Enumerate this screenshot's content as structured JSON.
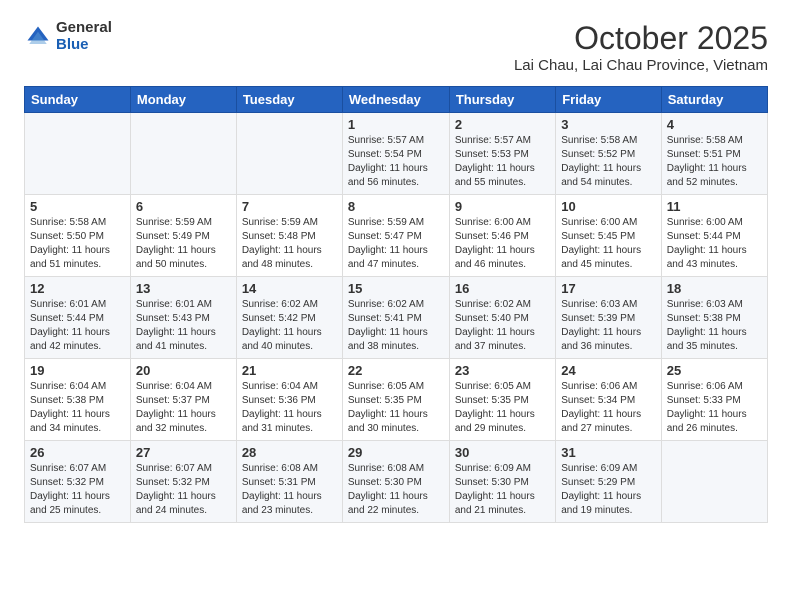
{
  "logo": {
    "general": "General",
    "blue": "Blue"
  },
  "header": {
    "month_year": "October 2025",
    "location": "Lai Chau, Lai Chau Province, Vietnam"
  },
  "weekdays": [
    "Sunday",
    "Monday",
    "Tuesday",
    "Wednesday",
    "Thursday",
    "Friday",
    "Saturday"
  ],
  "weeks": [
    [
      {
        "day": "",
        "info": ""
      },
      {
        "day": "",
        "info": ""
      },
      {
        "day": "",
        "info": ""
      },
      {
        "day": "1",
        "info": "Sunrise: 5:57 AM\nSunset: 5:54 PM\nDaylight: 11 hours and 56 minutes."
      },
      {
        "day": "2",
        "info": "Sunrise: 5:57 AM\nSunset: 5:53 PM\nDaylight: 11 hours and 55 minutes."
      },
      {
        "day": "3",
        "info": "Sunrise: 5:58 AM\nSunset: 5:52 PM\nDaylight: 11 hours and 54 minutes."
      },
      {
        "day": "4",
        "info": "Sunrise: 5:58 AM\nSunset: 5:51 PM\nDaylight: 11 hours and 52 minutes."
      }
    ],
    [
      {
        "day": "5",
        "info": "Sunrise: 5:58 AM\nSunset: 5:50 PM\nDaylight: 11 hours and 51 minutes."
      },
      {
        "day": "6",
        "info": "Sunrise: 5:59 AM\nSunset: 5:49 PM\nDaylight: 11 hours and 50 minutes."
      },
      {
        "day": "7",
        "info": "Sunrise: 5:59 AM\nSunset: 5:48 PM\nDaylight: 11 hours and 48 minutes."
      },
      {
        "day": "8",
        "info": "Sunrise: 5:59 AM\nSunset: 5:47 PM\nDaylight: 11 hours and 47 minutes."
      },
      {
        "day": "9",
        "info": "Sunrise: 6:00 AM\nSunset: 5:46 PM\nDaylight: 11 hours and 46 minutes."
      },
      {
        "day": "10",
        "info": "Sunrise: 6:00 AM\nSunset: 5:45 PM\nDaylight: 11 hours and 45 minutes."
      },
      {
        "day": "11",
        "info": "Sunrise: 6:00 AM\nSunset: 5:44 PM\nDaylight: 11 hours and 43 minutes."
      }
    ],
    [
      {
        "day": "12",
        "info": "Sunrise: 6:01 AM\nSunset: 5:44 PM\nDaylight: 11 hours and 42 minutes."
      },
      {
        "day": "13",
        "info": "Sunrise: 6:01 AM\nSunset: 5:43 PM\nDaylight: 11 hours and 41 minutes."
      },
      {
        "day": "14",
        "info": "Sunrise: 6:02 AM\nSunset: 5:42 PM\nDaylight: 11 hours and 40 minutes."
      },
      {
        "day": "15",
        "info": "Sunrise: 6:02 AM\nSunset: 5:41 PM\nDaylight: 11 hours and 38 minutes."
      },
      {
        "day": "16",
        "info": "Sunrise: 6:02 AM\nSunset: 5:40 PM\nDaylight: 11 hours and 37 minutes."
      },
      {
        "day": "17",
        "info": "Sunrise: 6:03 AM\nSunset: 5:39 PM\nDaylight: 11 hours and 36 minutes."
      },
      {
        "day": "18",
        "info": "Sunrise: 6:03 AM\nSunset: 5:38 PM\nDaylight: 11 hours and 35 minutes."
      }
    ],
    [
      {
        "day": "19",
        "info": "Sunrise: 6:04 AM\nSunset: 5:38 PM\nDaylight: 11 hours and 34 minutes."
      },
      {
        "day": "20",
        "info": "Sunrise: 6:04 AM\nSunset: 5:37 PM\nDaylight: 11 hours and 32 minutes."
      },
      {
        "day": "21",
        "info": "Sunrise: 6:04 AM\nSunset: 5:36 PM\nDaylight: 11 hours and 31 minutes."
      },
      {
        "day": "22",
        "info": "Sunrise: 6:05 AM\nSunset: 5:35 PM\nDaylight: 11 hours and 30 minutes."
      },
      {
        "day": "23",
        "info": "Sunrise: 6:05 AM\nSunset: 5:35 PM\nDaylight: 11 hours and 29 minutes."
      },
      {
        "day": "24",
        "info": "Sunrise: 6:06 AM\nSunset: 5:34 PM\nDaylight: 11 hours and 27 minutes."
      },
      {
        "day": "25",
        "info": "Sunrise: 6:06 AM\nSunset: 5:33 PM\nDaylight: 11 hours and 26 minutes."
      }
    ],
    [
      {
        "day": "26",
        "info": "Sunrise: 6:07 AM\nSunset: 5:32 PM\nDaylight: 11 hours and 25 minutes."
      },
      {
        "day": "27",
        "info": "Sunrise: 6:07 AM\nSunset: 5:32 PM\nDaylight: 11 hours and 24 minutes."
      },
      {
        "day": "28",
        "info": "Sunrise: 6:08 AM\nSunset: 5:31 PM\nDaylight: 11 hours and 23 minutes."
      },
      {
        "day": "29",
        "info": "Sunrise: 6:08 AM\nSunset: 5:30 PM\nDaylight: 11 hours and 22 minutes."
      },
      {
        "day": "30",
        "info": "Sunrise: 6:09 AM\nSunset: 5:30 PM\nDaylight: 11 hours and 21 minutes."
      },
      {
        "day": "31",
        "info": "Sunrise: 6:09 AM\nSunset: 5:29 PM\nDaylight: 11 hours and 19 minutes."
      },
      {
        "day": "",
        "info": ""
      }
    ]
  ]
}
